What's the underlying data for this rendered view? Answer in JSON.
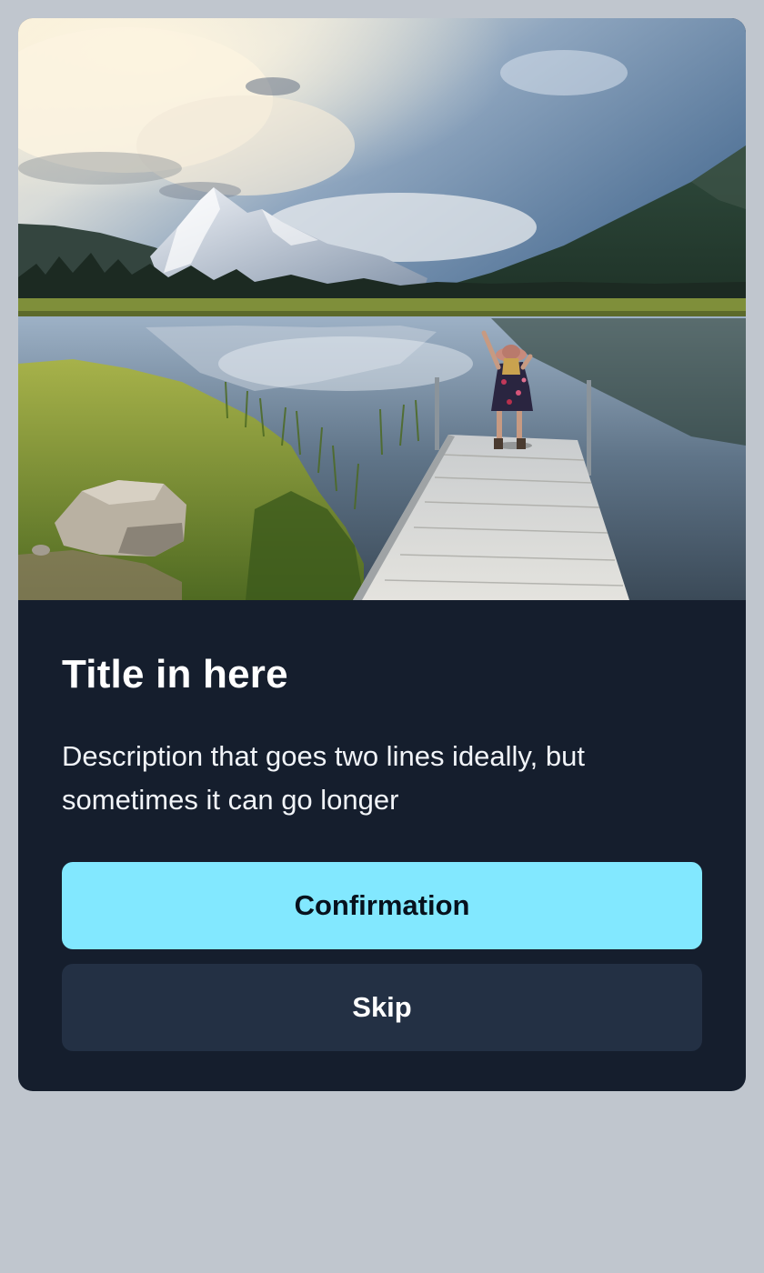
{
  "hero": {
    "image_alt": "Person standing on a wooden dock at a mountain lake"
  },
  "card": {
    "title": "Title in here",
    "description": "Description that goes two lines ideally, but sometimes it can go longer"
  },
  "actions": {
    "confirm_label": "Confirmation",
    "skip_label": "Skip"
  },
  "colors": {
    "page_background": "#c0c6ce",
    "card_background": "#151e2d",
    "confirm_button": "#82e8ff",
    "skip_button": "#233044"
  }
}
